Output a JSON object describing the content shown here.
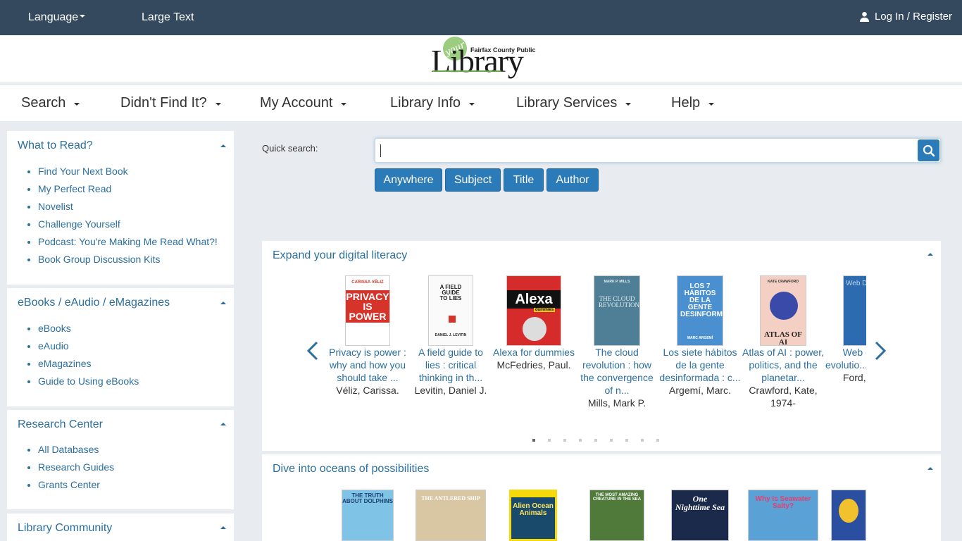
{
  "topbar": {
    "language": "Language",
    "large_text": "Large Text",
    "login": "Log In / Register"
  },
  "logo": {
    "your": "your",
    "fairfax": "Fairfax County Public",
    "library": "Library"
  },
  "nav": {
    "items": [
      "Search",
      "Didn't Find It?",
      "My Account",
      "Library Info",
      "Library Services",
      "Help"
    ]
  },
  "sidebar": {
    "sections": [
      {
        "title": "What to Read?",
        "links": [
          "Find Your Next Book",
          "My Perfect Read",
          "Novelist",
          "Challenge Yourself",
          "Podcast: You're Making Me Read What?!",
          "Book Group Discussion Kits"
        ]
      },
      {
        "title": "eBooks / eAudio / eMagazines",
        "links": [
          "eBooks",
          "eAudio",
          "eMagazines",
          "Guide to Using eBooks"
        ]
      },
      {
        "title": "Research Center",
        "links": [
          "All Databases",
          "Research Guides",
          "Grants Center"
        ]
      },
      {
        "title": "Library Community",
        "links": []
      }
    ]
  },
  "quick_search": {
    "label": "Quick search:",
    "value": "",
    "buttons": [
      "Anywhere",
      "Subject",
      "Title",
      "Author"
    ]
  },
  "carousel1": {
    "title": "Expand your digital literacy",
    "books": [
      {
        "title": "Privacy is power : why and how you should take ...",
        "author": "Véliz, Carissa.",
        "cover_text": "PRIVACY IS POWER",
        "cover_author": "CARISSA VÉLIZ"
      },
      {
        "title": "A field guide to lies : critical thinking in th...",
        "author": "Levitin, Daniel J.",
        "cover_text": "A FIELD GUIDE TO LIES",
        "cover_author": "DANIEL J. LEVITIN"
      },
      {
        "title": "Alexa for dummies",
        "author": "McFedries, Paul.",
        "cover_text": "Alexa",
        "cover_author": "dummies"
      },
      {
        "title": "The cloud revolution : how the convergence of n...",
        "author": "Mills, Mark P.",
        "cover_text": "THE CLOUD REVOLUTION",
        "cover_author": "MARK P. MILLS"
      },
      {
        "title": "Los siete hábitos de la gente desinformada : c...",
        "author": "Argemí, Marc.",
        "cover_text": "LOS 7 HÁBITOS DE LA GENTE DESINFORMADA",
        "cover_author": "MARC ARGEMÍ"
      },
      {
        "title": "Atlas of AI : power, politics, and the planetar...",
        "author": "Crawford, Kate, 1974-",
        "cover_text": "ATLAS OF AI",
        "cover_author": "KATE CRAWFORD"
      },
      {
        "title": "Web des... evolutio... digital ...",
        "author": "Ford, Ro...",
        "cover_text": "Web Des",
        "cover_author": ""
      }
    ],
    "page_count": 9,
    "active_page": 1
  },
  "carousel2": {
    "title": "Dive into oceans of possibilities",
    "books": [
      {
        "cover_text": "THE TRUTH ABOUT DOLPHINS"
      },
      {
        "cover_text": "THE ANTLERED SHIP"
      },
      {
        "cover_text": "Alien Ocean Animals"
      },
      {
        "cover_text": "THE MOST AMAZING CREATURE IN THE SEA"
      },
      {
        "cover_text": "One Nighttime Sea"
      },
      {
        "cover_text": "Why Is Seawater Salty?"
      },
      {
        "cover_text": ""
      }
    ]
  },
  "colors": {
    "topbar": "#34495e",
    "link": "#2b6f9e",
    "button": "#2b7bb9",
    "background": "#e8ebef"
  }
}
